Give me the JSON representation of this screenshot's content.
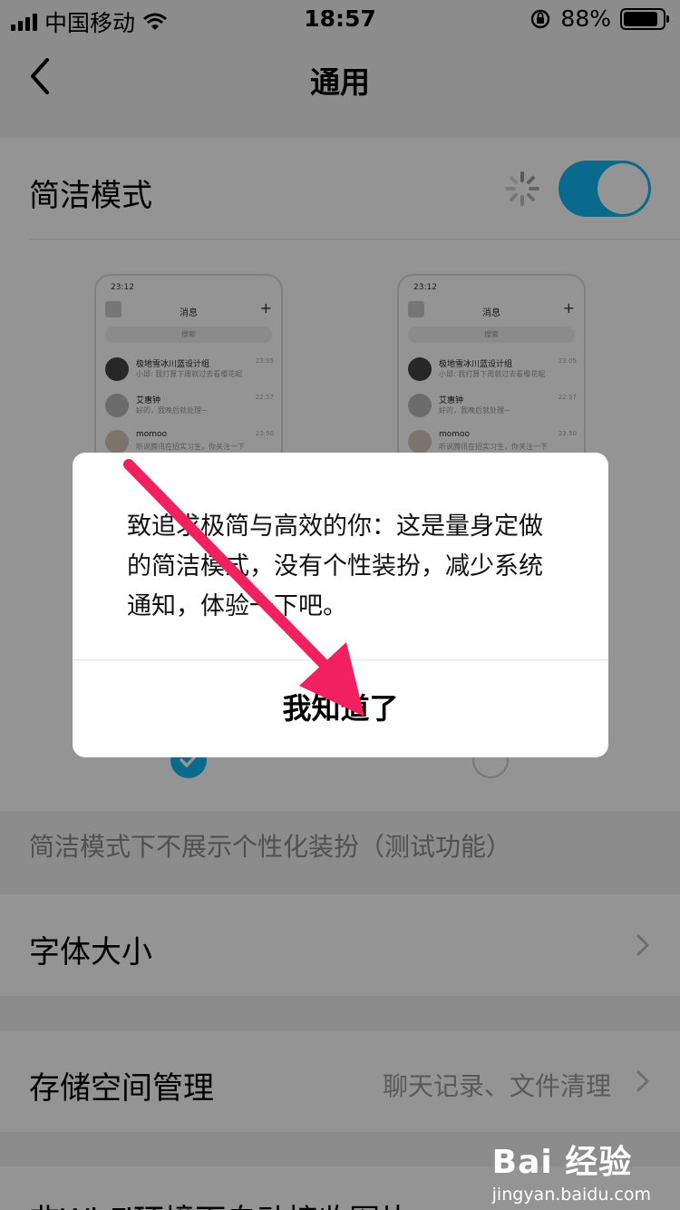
{
  "status_bar": {
    "carrier": "中国移动",
    "time": "18:57",
    "battery": "88%",
    "battery_level": 0.88
  },
  "nav": {
    "title": "通用"
  },
  "simple_mode": {
    "label": "简洁模式",
    "enabled": true,
    "hint": "简洁模式下不展示个性化装扮（测试功能）"
  },
  "preview": {
    "time": "23:12",
    "title": "消息",
    "search": "搜索",
    "items": [
      {
        "name": "极地雪冰川蓝设计组",
        "message": "小邱: 我打算下周就过去看樱花呢",
        "time": "23:05"
      },
      {
        "name": "艾惠钟",
        "message": "好的，我晚后就处理~",
        "time": "22:57"
      },
      {
        "name": "momoo",
        "message": "听说腾讯在招实习生，你关注一下",
        "time": "23:50"
      }
    ]
  },
  "font_size": {
    "label": "字体大小"
  },
  "storage": {
    "label": "存储空间管理",
    "sub": "聊天记录、文件清理"
  },
  "wifi_row": {
    "label": "非Wi-Fi环境下自动接收图片"
  },
  "dialog": {
    "message": "致追求极简与高效的你：这是量身定做的简洁模式，没有个性装扮，减少系统通知，体验一下吧。",
    "button": "我知道了"
  },
  "watermark": {
    "logo": "Bai 经验",
    "url": "jingyan.baidu.com"
  },
  "colors": {
    "accent": "#12b7f5",
    "arrow": "#f0215e"
  }
}
